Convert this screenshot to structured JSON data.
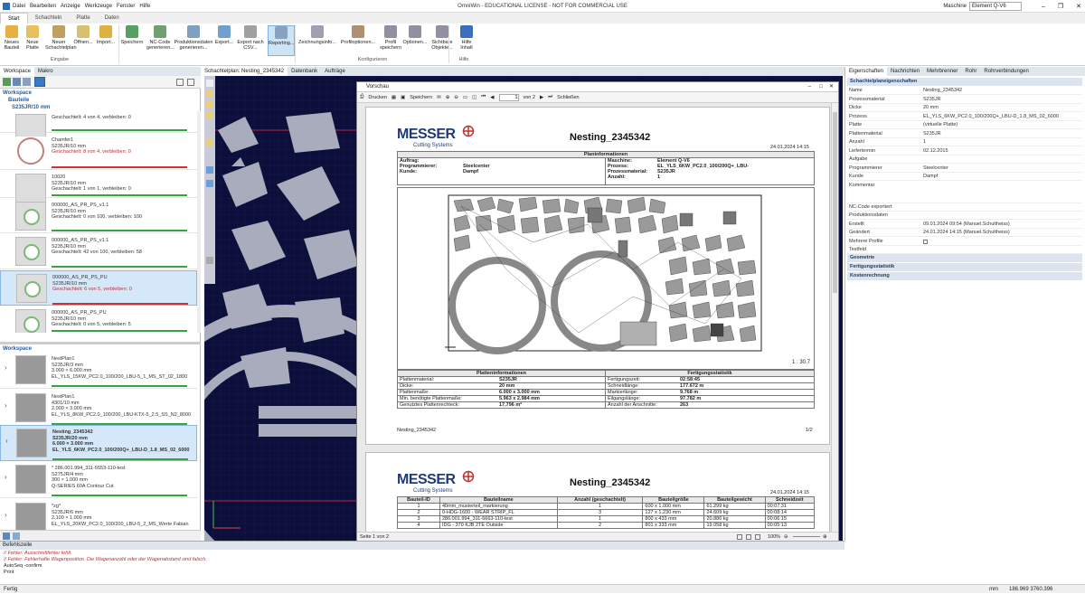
{
  "window": {
    "title": "OmniWin - EDUCATIONAL LICENSE - NOT FOR COMMERCIAL USE",
    "machine_label": "Maschine",
    "machine_value": "Element Q-V6"
  },
  "menu": [
    "Datei",
    "Bearbeiten",
    "Anzeige",
    "Werkzeuge",
    "Fenster",
    "Hilfe"
  ],
  "ribbon_tabs": [
    "Start",
    "Schachteln",
    "Platte",
    "Daten"
  ],
  "ribbon": {
    "buttons": [
      {
        "label": "Neues\nBauteil",
        "icon": "new-part-icon",
        "color": "#e8b040"
      },
      {
        "label": "Neue\nPlatte",
        "icon": "new-plate-icon",
        "color": "#e8c060"
      },
      {
        "label": "Neuer\nSchachtelplan",
        "icon": "new-nestplan-icon",
        "color": "#c0a060"
      },
      {
        "label": "Öffnen...",
        "icon": "open-xml-icon",
        "color": "#d8c070"
      },
      {
        "label": "Import...",
        "icon": "import-icon",
        "color": "#e0b040"
      },
      {
        "label": "Speichern",
        "icon": "save-icon",
        "color": "#58a060"
      },
      {
        "label": "NC-Code\ngenerieren...",
        "icon": "nc-code-icon",
        "color": "#70a070"
      },
      {
        "label": "Produktionsdaten\ngenerieren...",
        "icon": "production-data-icon",
        "color": "#80a0c0"
      },
      {
        "label": "Export...",
        "icon": "export-icon",
        "color": "#70a0d0"
      },
      {
        "label": "Export nach\nCSV...",
        "icon": "csv-icon",
        "color": "#a0a0a0"
      },
      {
        "label": "Reporting...",
        "icon": "printer-icon",
        "color": "#8aa0c0"
      },
      {
        "label": "Zeichnungsinfo...",
        "icon": "drawing-info-icon",
        "color": "#a0a0b0"
      },
      {
        "label": "Profiloptionen...",
        "icon": "profile-options-icon",
        "color": "#b09070"
      },
      {
        "label": "Profil\nspeichern",
        "icon": "profile-save-icon",
        "color": "#9090a0"
      },
      {
        "label": "Optionen...",
        "icon": "options-icon",
        "color": "#9090a0"
      },
      {
        "label": "Sichtbare\nObjekte...",
        "icon": "visible-objects-icon",
        "color": "#9090a0"
      },
      {
        "label": "Hilfe\nInhalt",
        "icon": "help-icon",
        "color": "#3a6fc0"
      }
    ],
    "groups": [
      "Eingabe",
      "Konfigurieren",
      "Hilfe"
    ]
  },
  "left": {
    "tabs": [
      "Workspace",
      "Makro"
    ],
    "tree_header": "Workspace",
    "subheader1": "Bauteile",
    "subheader2": "S235JR/10 mm",
    "parts": [
      {
        "name": "",
        "line2": "",
        "line3": "Geschachtelt: 4 von 4, verbleiben: 0",
        "red": false,
        "bar": "#3aa040"
      },
      {
        "name": "Chamfer1",
        "line2": "S235JR/10 mm",
        "line3": "Geschachtelt: 8 von 4, verbleiben: 0",
        "red": true,
        "bar": "#d03030"
      },
      {
        "name": "10020",
        "line2": "S235JR/10 mm",
        "line3": "Geschachtelt: 1 von 1, verbleiben: 0",
        "red": false,
        "bar": "#3aa040"
      },
      {
        "name": "000000_AS_PR_PS_v1.1",
        "line2": "S235JR/10 mm",
        "line3": "Geschachtelt: 0 von 100, verbleiben: 100",
        "red": false,
        "bar": "#3aa040"
      },
      {
        "name": "000000_AS_PR_PS_v1.1",
        "line2": "S235JR/10 mm",
        "line3": "Geschachtelt: 42 von 100, verbleiben: 58",
        "red": false,
        "bar": "#3aa040"
      },
      {
        "name": "000000_AS_PR_PS_PU",
        "line2": "S235JR/10 mm",
        "line3": "Geschachtelt: 6 von 5, verbleiben: 0",
        "red": true,
        "bar": "#d03030"
      },
      {
        "name": "000000_AS_PR_PS_PU",
        "line2": "S235JR/10 mm",
        "line3": "Geschachtelt: 0 von 5, verbleiben: 5",
        "red": false,
        "bar": "#3aa040"
      }
    ],
    "workspace_header": "Workspace",
    "plans": [
      {
        "name": "NestPlan1",
        "l2": "S235JR/3 mm",
        "l3": "3.000 × 6.000 mm",
        "l4": "EL_YLS_15KW_PC2.0_100/200_LBU-5_1_MS_ST_02_1800",
        "bold": false
      },
      {
        "name": "NestPlan1",
        "l2": "4301/10 mm",
        "l3": "2.000 × 3.000 mm",
        "l4": "EL_YLS_8KW_PC2.0_100/200_LBU-KTX-5_2.5_SS_N2_8000",
        "bold": false
      },
      {
        "name": "Nesting_2345342",
        "l2": "S235JR/20 mm",
        "l3": "6.000 × 3.000 mm",
        "l4": "EL_YLS_6KW_PC2.0_100/200Q+_LBU-D_1.8_MS_02_6000",
        "bold": true
      },
      {
        "name": "* 286.001.994_311-5553-110-test",
        "l2": "S275JR/4 mm",
        "l3": "300 × 1.000 mm",
        "l4": "Q-SERIES 60A Contour Cut",
        "bold": false
      },
      {
        "name": "*zg*",
        "l2": "S235JR/6 mm",
        "l3": "2.100 × 1.000 mm",
        "l4": "EL_YLS_20KW_PC2.0_100/200_LBU-5_2_MS_Werte Fabian",
        "bold": false
      }
    ]
  },
  "doc_tabs": [
    "Schachtelplan: Nesting_2345342",
    "Datenbank",
    "Aufträge"
  ],
  "preview": {
    "title": "Vorschau",
    "toolbar": {
      "print": "Drucken",
      "save": "Speichern",
      "page": "1",
      "of": "von 2",
      "close": "Schließen"
    },
    "status": "Seite 1 von 2",
    "zoom": "100%",
    "page1": {
      "logo": "MESSER",
      "logo_sub": "Cutting Systems",
      "title": "Nesting_2345342",
      "date": "24.01.2024 14:15",
      "plan_info_header": "Planinformationen",
      "left_info": [
        {
          "k": "Auftrag:",
          "v": ""
        },
        {
          "k": "Programmierer:",
          "v": "Steelcenter"
        },
        {
          "k": "Kunde:",
          "v": "Dampf"
        }
      ],
      "right_info": [
        {
          "k": "Maschine:",
          "v": "Element Q-V6"
        },
        {
          "k": "Prozess:",
          "v": "EL_YLS_6KW_PC2.0_100/200Q+_LBU-"
        },
        {
          "k": "Prozessmaterial:",
          "v": "S235JR"
        },
        {
          "k": "Anzahl:",
          "v": "1"
        }
      ],
      "scale": "1 : 30.7",
      "plate_header": "Platteninformationen",
      "stats_header": "Fertigungsstatistik",
      "plate_info": [
        {
          "k": "Plattenmaterial:",
          "v": "S235JR"
        },
        {
          "k": "Dicke:",
          "v": "20 mm"
        },
        {
          "k": "Plattenmaße:",
          "v": "6.000 x 3.000 mm"
        },
        {
          "k": "Min. benötigte Plattenmaße:",
          "v": "5.963 x 2.984 mm"
        },
        {
          "k": "Genutztes Plattenrechteck:",
          "v": "17,796 m²"
        }
      ],
      "stats": [
        {
          "k": "Fertigungszeit:",
          "v": "02:58:45"
        },
        {
          "k": "Schneidlänge:",
          "v": "177.672 m"
        },
        {
          "k": "Markierlänge:",
          "v": "9.768 m"
        },
        {
          "k": "Eilgangslänge:",
          "v": "97.782 m"
        },
        {
          "k": "Anzahl der Anschnitte:",
          "v": "263"
        }
      ],
      "footer_left": "Nesting_2345342",
      "footer_right": "1/2"
    },
    "page2": {
      "logo": "MESSER",
      "logo_sub": "Cutting Systems",
      "title": "Nesting_2345342",
      "date": "24.01.2024 14:15",
      "columns": [
        "Bauteil-ID",
        "Bauteilname",
        "Anzahl (geschachtelt)",
        "Bauteilgröße",
        "Bauteilgewicht",
        "Schneidzeit"
      ],
      "rows": [
        [
          "1",
          "40mm_musterteil_markierung",
          "1",
          "600 x 1.000 mm",
          "61.299 kg",
          "00:07:31"
        ],
        [
          "2",
          "0-HDG-1600 - WEAR STRIP_FL",
          "3",
          "127 x 1.230 mm",
          "24.609 kg",
          "00:08:14"
        ],
        [
          "3",
          "286.001.994_311-6663-110-test",
          "1",
          "800 x 433 mm",
          "20.886 kg",
          "00:06:15"
        ],
        [
          "4",
          "IDG - 370 KJB 2TE Outside",
          "2",
          "801 x 333 mm",
          "19.058 kg",
          "00:05:13"
        ]
      ]
    }
  },
  "right": {
    "tabs": [
      "Eigenschaften",
      "Nachrichten",
      "Mehrbrenner",
      "Rohr",
      "Rohrverbindungen"
    ],
    "section": "Schachtelplaneigenschaften",
    "props": [
      {
        "k": "Name",
        "v": "Nesting_2345342"
      },
      {
        "k": "Prozessmaterial",
        "v": "S235JR"
      },
      {
        "k": "Dicke",
        "v": "20 mm"
      },
      {
        "k": "Prozess",
        "v": "EL_YLS_6KW_PC2.0_100/200Q+_LBU-D_1.8_MS_02_6000"
      },
      {
        "k": "Platte",
        "v": "(virtuelle Platte)"
      },
      {
        "k": "Plattenmaterial",
        "v": "S235JR"
      },
      {
        "k": "Anzahl",
        "v": "1"
      },
      {
        "k": "Liefertermin",
        "v": "02.12.2015"
      },
      {
        "k": "Aufgabe",
        "v": ""
      },
      {
        "k": "Programmierer",
        "v": "Steelcenter"
      },
      {
        "k": "Kunde",
        "v": "Dampf"
      },
      {
        "k": "Kommentar",
        "v": ""
      }
    ],
    "props2": [
      {
        "k": "NC-Code exportiert",
        "v": ""
      },
      {
        "k": "Produktionsdaten",
        "v": ""
      },
      {
        "k": "Erstellt",
        "v": "09.01.2024 09:54 (Manuel.Schultheiss)"
      },
      {
        "k": "Geändert",
        "v": "24.01.2024 14:15 (Manuel.Schultheiss)"
      },
      {
        "k": "Mehrere Profile",
        "v": ""
      },
      {
        "k": "Testfeld",
        "v": ""
      }
    ],
    "collapsed": [
      "Geometrie",
      "Fertigungsstatistik",
      "Kostenrechnung"
    ]
  },
  "command": {
    "header": "Befehlszeile",
    "lines": [
      {
        "t": "// Fehler: Ausschnittfehler fehlt.",
        "red": true
      },
      {
        "t": "// Fehler: Fehlerhafte Wagenposition. Die Wagenanzahl oder der Wagenabstand sind falsch.",
        "red": true
      },
      {
        "t": "AutoSeq -confirm",
        "red": false
      },
      {
        "t": "Print",
        "red": false
      }
    ]
  },
  "status": {
    "left": "Fertig",
    "unit": "mm",
    "coords": "186.969 3760.396"
  }
}
